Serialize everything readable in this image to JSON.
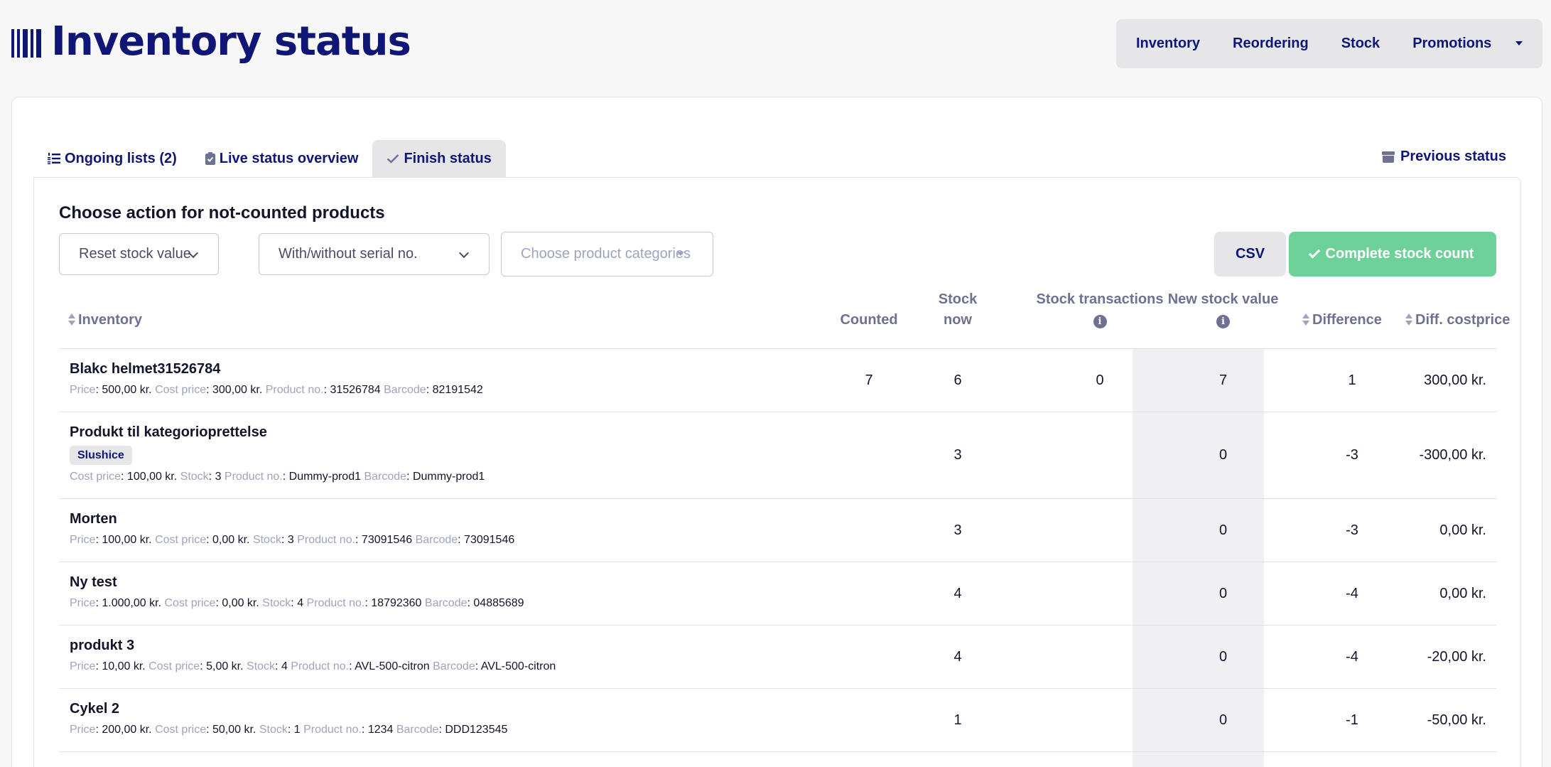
{
  "header": {
    "title": "Inventory status",
    "nav": [
      "Inventory",
      "Reordering",
      "Stock",
      "Promotions"
    ]
  },
  "tabs": [
    {
      "label": "Ongoing lists (2)",
      "icon": "numbered-list-icon"
    },
    {
      "label": "Live status overview",
      "icon": "clipboard-check-icon"
    },
    {
      "label": "Finish status",
      "icon": "check-icon"
    }
  ],
  "previous_status": {
    "label": "Previous status",
    "icon": "archive-icon"
  },
  "section": {
    "title": "Choose action for not-counted products"
  },
  "filters": {
    "reset": "Reset stock value",
    "serial": "With/without serial no.",
    "categories_placeholder": "Choose product categories"
  },
  "buttons": {
    "csv": "CSV",
    "complete": "Complete stock count"
  },
  "table": {
    "columns": {
      "inventory": "Inventory",
      "counted": "Counted",
      "stock_now_1": "Stock",
      "stock_now_2": "now",
      "stock_transactions": "Stock transactions",
      "new_stock_value": "New stock value",
      "difference": "Difference",
      "diff_costprice": "Diff. costprice"
    },
    "rows": [
      {
        "name": "Blakc helmet31526784",
        "meta": [
          [
            "Price",
            "500,00 kr."
          ],
          [
            "Cost price",
            "300,00 kr."
          ],
          [
            "Product no.",
            "31526784"
          ],
          [
            "Barcode",
            "82191542"
          ]
        ],
        "counted": "7",
        "stock_now": "6",
        "stock_transactions": "0",
        "new_stock_value": "7",
        "difference": "1",
        "diff_costprice": "300,00 kr."
      },
      {
        "name": "Produkt til kategorioprettelse",
        "badge": "Slushice",
        "meta": [
          [
            "Cost price",
            "100,00 kr."
          ],
          [
            "Stock",
            "3"
          ],
          [
            "Product no.",
            "Dummy-prod1"
          ],
          [
            "Barcode",
            "Dummy-prod1"
          ]
        ],
        "counted": "",
        "stock_now": "3",
        "stock_transactions": "",
        "new_stock_value": "0",
        "difference": "-3",
        "diff_costprice": "-300,00 kr."
      },
      {
        "name": "Morten",
        "meta": [
          [
            "Price",
            "100,00 kr."
          ],
          [
            "Cost price",
            "0,00 kr."
          ],
          [
            "Stock",
            "3"
          ],
          [
            "Product no.",
            "73091546"
          ],
          [
            "Barcode",
            "73091546"
          ]
        ],
        "counted": "",
        "stock_now": "3",
        "stock_transactions": "",
        "new_stock_value": "0",
        "difference": "-3",
        "diff_costprice": "0,00 kr."
      },
      {
        "name": "Ny test",
        "meta": [
          [
            "Price",
            "1.000,00 kr."
          ],
          [
            "Cost price",
            "0,00 kr."
          ],
          [
            "Stock",
            "4"
          ],
          [
            "Product no.",
            "18792360"
          ],
          [
            "Barcode",
            "04885689"
          ]
        ],
        "counted": "",
        "stock_now": "4",
        "stock_transactions": "",
        "new_stock_value": "0",
        "difference": "-4",
        "diff_costprice": "0,00 kr."
      },
      {
        "name": "produkt 3",
        "meta": [
          [
            "Price",
            "10,00 kr."
          ],
          [
            "Cost price",
            "5,00 kr."
          ],
          [
            "Stock",
            "4"
          ],
          [
            "Product no.",
            "AVL-500-citron"
          ],
          [
            "Barcode",
            "AVL-500-citron"
          ]
        ],
        "counted": "",
        "stock_now": "4",
        "stock_transactions": "",
        "new_stock_value": "0",
        "difference": "-4",
        "diff_costprice": "-20,00 kr."
      },
      {
        "name": "Cykel 2",
        "meta": [
          [
            "Price",
            "200,00 kr."
          ],
          [
            "Cost price",
            "50,00 kr."
          ],
          [
            "Stock",
            "1"
          ],
          [
            "Product no.",
            "1234"
          ],
          [
            "Barcode",
            "DDD123545"
          ]
        ],
        "counted": "",
        "stock_now": "1",
        "stock_transactions": "",
        "new_stock_value": "0",
        "difference": "-1",
        "diff_costprice": "-50,00 kr."
      }
    ]
  }
}
